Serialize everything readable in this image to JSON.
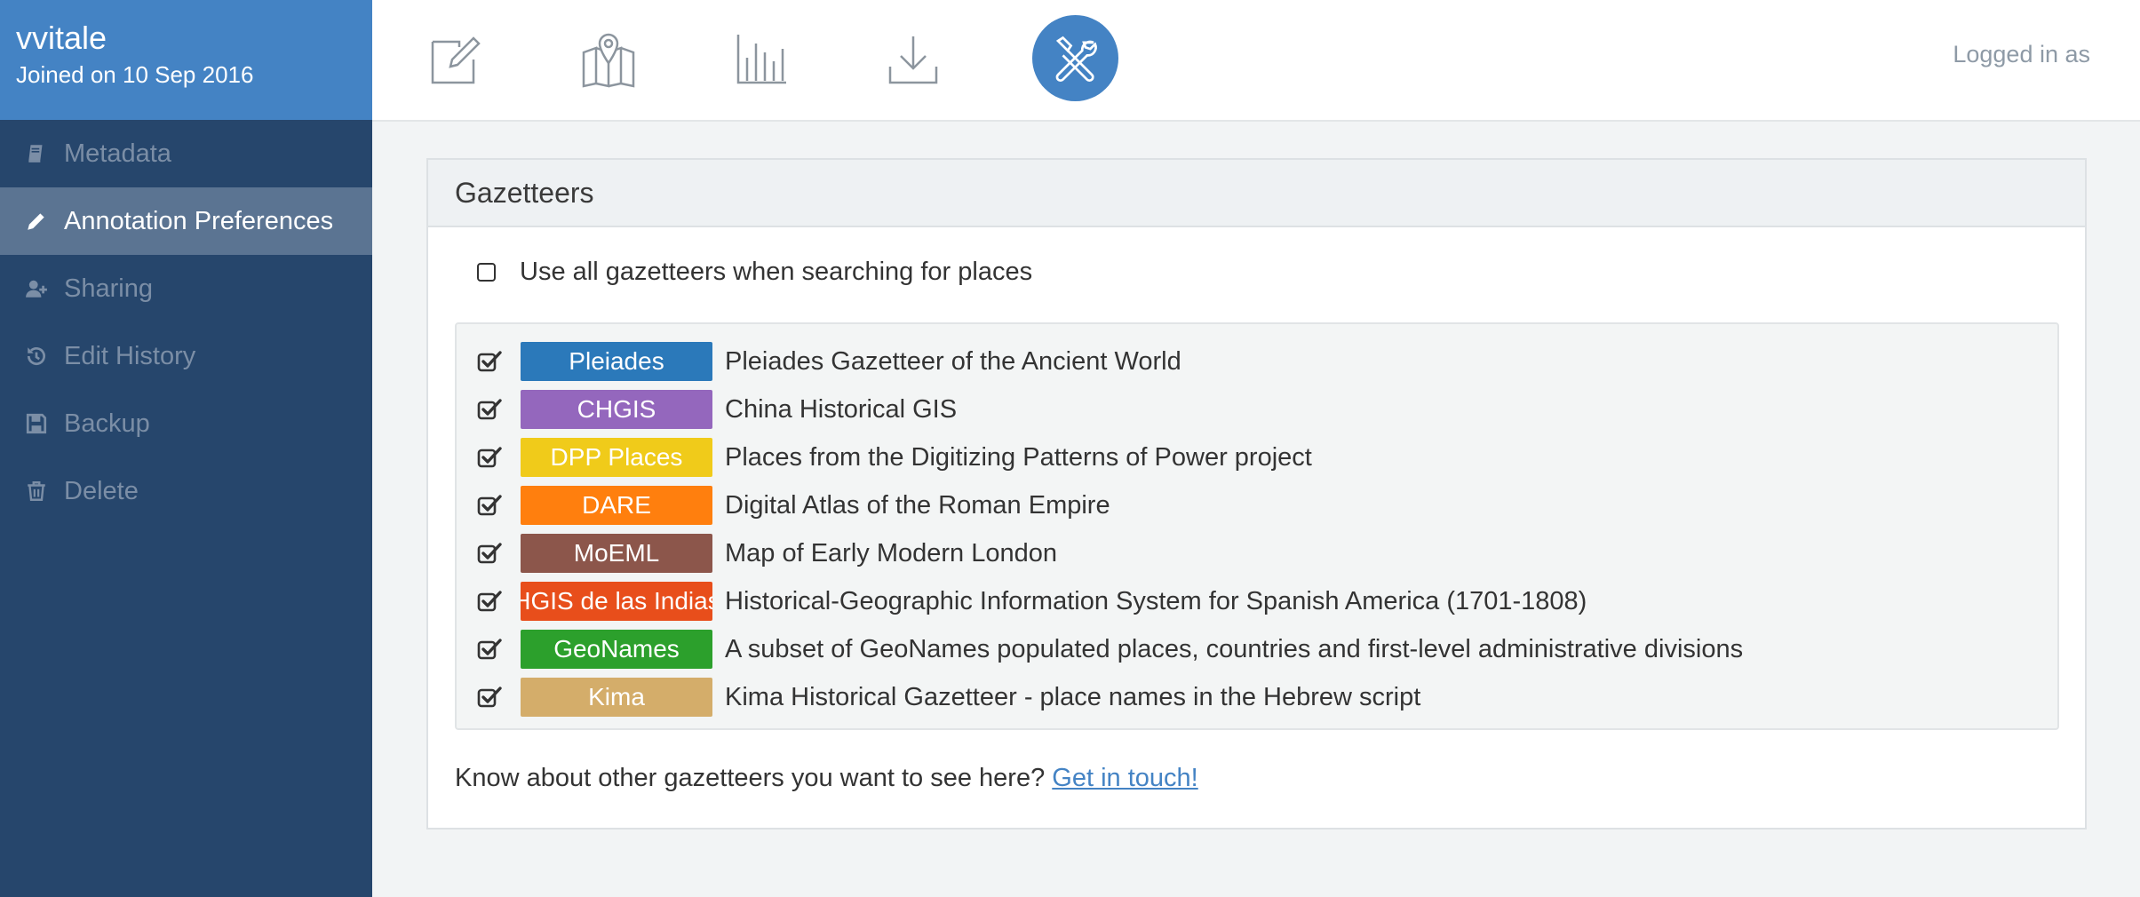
{
  "user": {
    "name": "vvitale",
    "joined": "Joined on 10 Sep 2016"
  },
  "sidebar": {
    "items": [
      {
        "label": "Metadata",
        "icon": "book-icon",
        "active": false
      },
      {
        "label": "Annotation Preferences",
        "icon": "pencil-icon",
        "active": true
      },
      {
        "label": "Sharing",
        "icon": "add-user-icon",
        "active": false
      },
      {
        "label": "Edit History",
        "icon": "history-icon",
        "active": false
      },
      {
        "label": "Backup",
        "icon": "save-icon",
        "active": false
      },
      {
        "label": "Delete",
        "icon": "trash-icon",
        "active": false
      }
    ]
  },
  "topbar": {
    "icons": [
      "edit-document-icon",
      "map-icon",
      "bar-chart-icon",
      "download-icon",
      "tools-icon"
    ],
    "active_icon": "tools-icon",
    "logged_in": "Logged in as"
  },
  "panel": {
    "title": "Gazetteers",
    "use_all_label": "Use all gazetteers when searching for places",
    "use_all_checked": false,
    "gazetteers": [
      {
        "badge": "Pleiades",
        "color": "#2b79ba",
        "description": "Pleiades Gazetteer of the Ancient World",
        "checked": true
      },
      {
        "badge": "CHGIS",
        "color": "#9467bd",
        "description": "China Historical GIS",
        "checked": true
      },
      {
        "badge": "DPP Places",
        "color": "#f0cb1a",
        "description": "Places from the Digitizing Patterns of Power project",
        "checked": true
      },
      {
        "badge": "DARE",
        "color": "#ff7f0e",
        "description": "Digital Atlas of the Roman Empire",
        "checked": true
      },
      {
        "badge": "MoEML",
        "color": "#8c564b",
        "description": "Map of Early Modern London",
        "checked": true
      },
      {
        "badge": "HGIS de las Indias",
        "color": "#e84e1b",
        "description": "Historical-Geographic Information System for Spanish America (1701-1808)",
        "checked": true
      },
      {
        "badge": "GeoNames",
        "color": "#2ca02c",
        "description": "A subset of GeoNames populated places, countries and first-level administrative divisions",
        "checked": true
      },
      {
        "badge": "Kima",
        "color": "#d4ad6a",
        "description": "Kima Historical Gazetteer - place names in the Hebrew script",
        "checked": true
      }
    ],
    "footer_text": "Know about other gazetteers you want to see here?",
    "footer_link": "Get in touch!"
  },
  "colors": {
    "sidebar_bg": "#26466c",
    "user_box_bg": "#4483c4",
    "active_item_bg": "#5b7492",
    "accent": "#4483c4"
  }
}
